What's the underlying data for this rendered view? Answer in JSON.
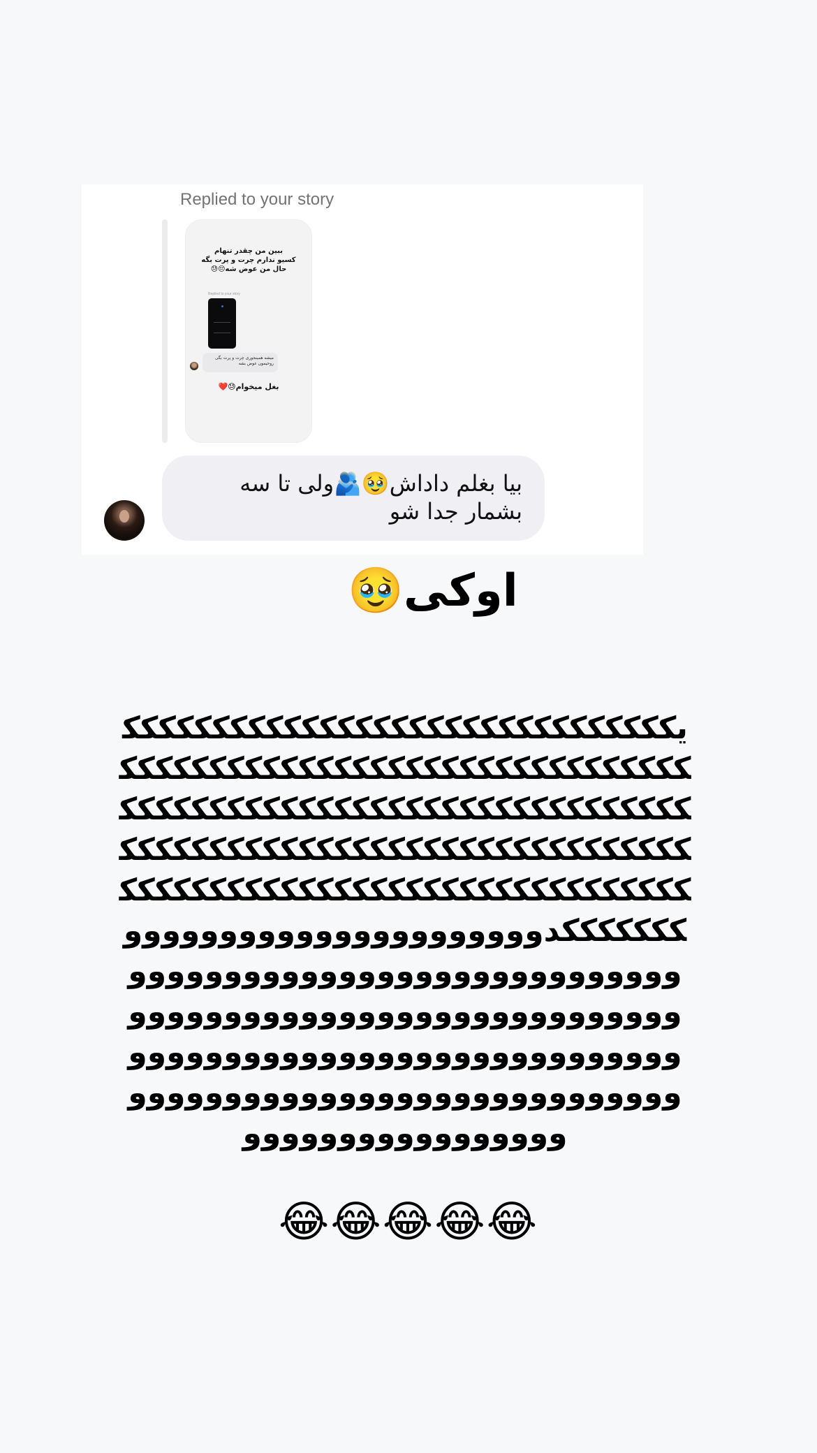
{
  "reply": {
    "header": "Replied to your story",
    "story_thumbnail": {
      "top_text_lines": [
        "ببین من چقدر تنهام",
        "کسیو ندارم چرت و پرت بگه",
        "حال من عوض شه😔😓"
      ],
      "replied_label": "Replied to your story",
      "reply_text": "میشه همینجوری چرت و پرت بگی روحیمون عوض بشه",
      "bottom_text": "بغل میخوام😓❤️"
    },
    "message": "بیا بغلم داداش🥹🫂ولی تا سه بشمار جدا شو",
    "avatar_icon": "user-avatar"
  },
  "caption": "اوکی🥹",
  "long_text": "یککککککککککککککککککککککککککککککککککککککککککککککککککککککککککککککککککککککککککککککککککککککککککککککککککککککککککککککککککککککککککککککککککککککککککککککککککککککککککککککککککککککدووووووووووووووووووووووووووووووووووووووووووووووووووووووووووووووووووووووووووووووووووووووووووووووووووووووووووووووووووووووووووووووووووووووووووووووووووووووووووو",
  "emojis": "😂😂😂😂😂"
}
